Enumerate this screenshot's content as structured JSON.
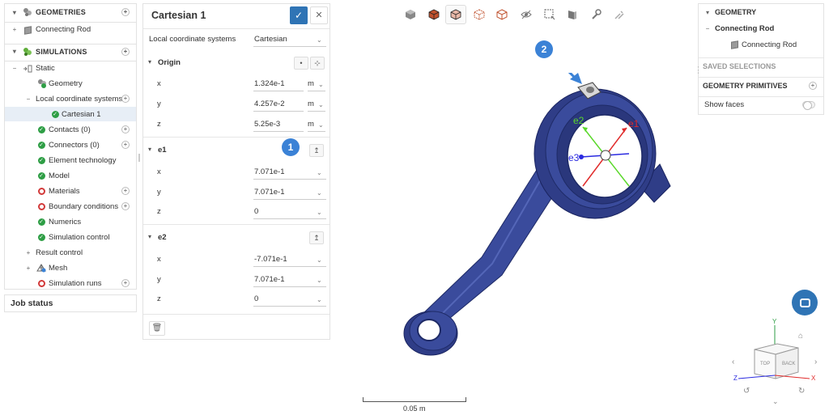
{
  "tree": {
    "geometries": {
      "label": "GEOMETRIES",
      "item": "Connecting Rod"
    },
    "simulations": {
      "label": "SIMULATIONS",
      "static": "Static",
      "items": [
        {
          "label": "Geometry"
        },
        {
          "label": "Local coordinate systems"
        },
        {
          "label": "Cartesian 1"
        },
        {
          "label": "Contacts (0)"
        },
        {
          "label": "Connectors (0)"
        },
        {
          "label": "Element technology"
        },
        {
          "label": "Model"
        },
        {
          "label": "Materials"
        },
        {
          "label": "Boundary conditions"
        },
        {
          "label": "Numerics"
        },
        {
          "label": "Simulation control"
        },
        {
          "label": "Result control"
        },
        {
          "label": "Mesh"
        },
        {
          "label": "Simulation runs"
        }
      ]
    },
    "job_status": "Job status"
  },
  "props": {
    "title": "Cartesian 1",
    "lcs_label": "Local coordinate systems",
    "lcs_value": "Cartesian",
    "origin": {
      "label": "Origin",
      "x_label": "x",
      "x": "1.324e-1",
      "x_unit": "m",
      "y_label": "y",
      "y": "4.257e-2",
      "y_unit": "m",
      "z_label": "z",
      "z": "5.25e-3",
      "z_unit": "m"
    },
    "e1": {
      "label": "e1",
      "x_label": "x",
      "x": "7.071e-1",
      "y_label": "y",
      "y": "7.071e-1",
      "z_label": "z",
      "z": "0"
    },
    "e2": {
      "label": "e2",
      "x_label": "x",
      "x": "-7.071e-1",
      "y_label": "y",
      "y": "7.071e-1",
      "z_label": "z",
      "z": "0"
    }
  },
  "badges": {
    "one": "1",
    "two": "2"
  },
  "right_panel": {
    "geometry": "GEOMETRY",
    "connecting_rod": "Connecting Rod",
    "connecting_rod_part": "Connecting Rod",
    "saved_selections": "SAVED SELECTIONS",
    "geometry_primitives": "GEOMETRY PRIMITIVES",
    "show_faces": "Show faces"
  },
  "viewport": {
    "axis_labels": {
      "e1": "e1",
      "e2": "e2",
      "e3": "e3"
    },
    "scale_label": "0.05 m",
    "cube_faces": {
      "top": "TOP",
      "back": "BACK"
    },
    "triad": {
      "y": "Y",
      "z": "Z",
      "x": "X"
    }
  },
  "colors": {
    "accent": "#2f74b5",
    "part": "#3a4b9c",
    "ok": "#2e9e45",
    "error": "#d23a3a"
  }
}
